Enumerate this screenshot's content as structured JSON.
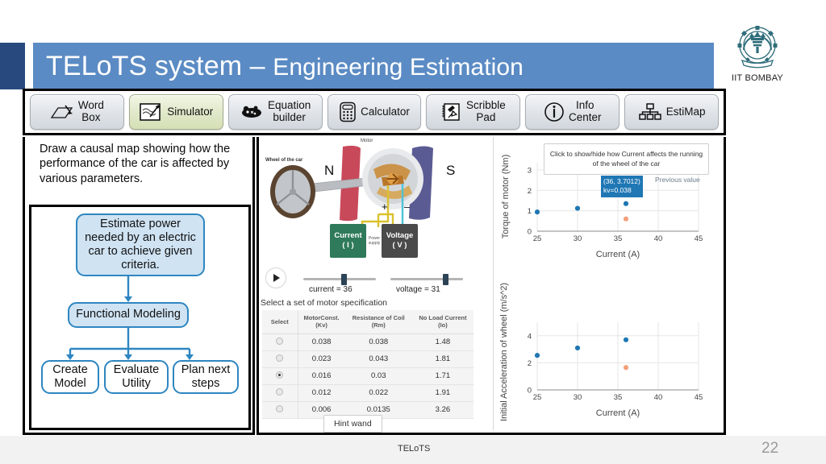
{
  "header": {
    "title_main": "TELoTS system – ",
    "title_sub": "Engineering Estimation",
    "logo_caption": "IIT BOMBAY",
    "logo_icon": "iit-bombay-emblem-icon"
  },
  "toolbar": {
    "items": [
      {
        "label": "Word\nBox",
        "icon": "word-box-icon",
        "active": false
      },
      {
        "label": "Simulator",
        "icon": "simulator-icon",
        "active": true
      },
      {
        "label": "Equation\nbuilder",
        "icon": "equation-builder-icon",
        "active": false
      },
      {
        "label": "Calculator",
        "icon": "calculator-icon",
        "active": false
      },
      {
        "label": "Scribble\nPad",
        "icon": "scribble-pad-icon",
        "active": false
      },
      {
        "label": "Info\nCenter",
        "icon": "info-center-icon",
        "active": false
      },
      {
        "label": "EstiMap",
        "icon": "estimap-icon",
        "active": false
      }
    ]
  },
  "left_panel": {
    "instruction": "Draw a causal map showing how the performance of the car is affected by various parameters.",
    "flow": {
      "top": "Estimate power needed by an electric car to achieve given criteria.",
      "middle": "Functional Modeling",
      "bottom": [
        "Create Model",
        "Evaluate Utility",
        "Plan next steps"
      ]
    }
  },
  "simulator": {
    "labels": {
      "motor": "Motor",
      "wheel": "Wheel of the car",
      "pole_north": "N",
      "pole_south": "S",
      "terminal_plus": "+",
      "terminal_minus": "–",
      "power_supply": "Power supply",
      "current_box": "Current",
      "current_box_unit": "( I )",
      "voltage_box": "Voltage",
      "voltage_box_unit": "( V )"
    },
    "play_icon": "play-icon",
    "sliders": [
      {
        "name": "current",
        "readout": "current = 36",
        "value": 36,
        "position_pct": 52
      },
      {
        "name": "voltage",
        "readout": "voltage = 31",
        "value": 31,
        "position_pct": 72
      }
    ],
    "spec_title": "Select a set of motor specification",
    "spec_table": {
      "columns": [
        "Select",
        "MotorConst.\n(Kv)",
        "Resistance of Coil\n(Rm)",
        "No Load Current\n(Io)"
      ],
      "rows": [
        {
          "selected": false,
          "kv": "0.038",
          "rm": "0.038",
          "io": "1.48"
        },
        {
          "selected": false,
          "kv": "0.023",
          "rm": "0.043",
          "io": "1.81"
        },
        {
          "selected": true,
          "kv": "0.016",
          "rm": "0.03",
          "io": "1.71"
        },
        {
          "selected": false,
          "kv": "0.012",
          "rm": "0.022",
          "io": "1.91"
        },
        {
          "selected": false,
          "kv": "0.006",
          "rm": "0.0135",
          "io": "3.26"
        }
      ]
    },
    "hint_button": "Hint wand",
    "callout": "Click to show/hide how Current affects the running of the wheel of the car",
    "tooltip_value": "(36, 3.7012)",
    "tooltip_kv": "kv=0.038",
    "tooltip_prev_label": "Previous value"
  },
  "chart_data": [
    {
      "type": "scatter",
      "title": "",
      "xlabel": "Current (A)",
      "ylabel": "Torque of motor (Nm)",
      "xlim": [
        25,
        45
      ],
      "ylim": [
        0,
        3.35
      ],
      "xticks": [
        25,
        30,
        35,
        40,
        45
      ],
      "yticks": [
        0,
        1,
        2,
        3
      ],
      "grid": true,
      "legend": "none",
      "series": [
        {
          "name": "current",
          "color": "#1f77b4",
          "points": [
            [
              25,
              0.94
            ],
            [
              30,
              1.12
            ],
            [
              36,
              1.35
            ]
          ]
        },
        {
          "name": "previous",
          "color": "#f2a07b",
          "points": [
            [
              36,
              0.6
            ]
          ]
        }
      ]
    },
    {
      "type": "scatter",
      "title": "",
      "xlabel": "Current (A)",
      "ylabel": "Initial Acceleration of wheel (m/s^2)",
      "xlim": [
        25,
        45
      ],
      "ylim": [
        0,
        5.0
      ],
      "xticks": [
        25,
        30,
        35,
        40,
        45
      ],
      "yticks": [
        0,
        2,
        4
      ],
      "grid": true,
      "legend": "none",
      "series": [
        {
          "name": "current",
          "color": "#1f77b4",
          "points": [
            [
              25,
              2.55
            ],
            [
              30,
              3.1
            ],
            [
              36,
              3.7012
            ]
          ]
        },
        {
          "name": "previous",
          "color": "#f2a07b",
          "points": [
            [
              36,
              1.65
            ]
          ]
        }
      ]
    }
  ],
  "footer": {
    "label": "TELoTS",
    "page_number": "22"
  }
}
